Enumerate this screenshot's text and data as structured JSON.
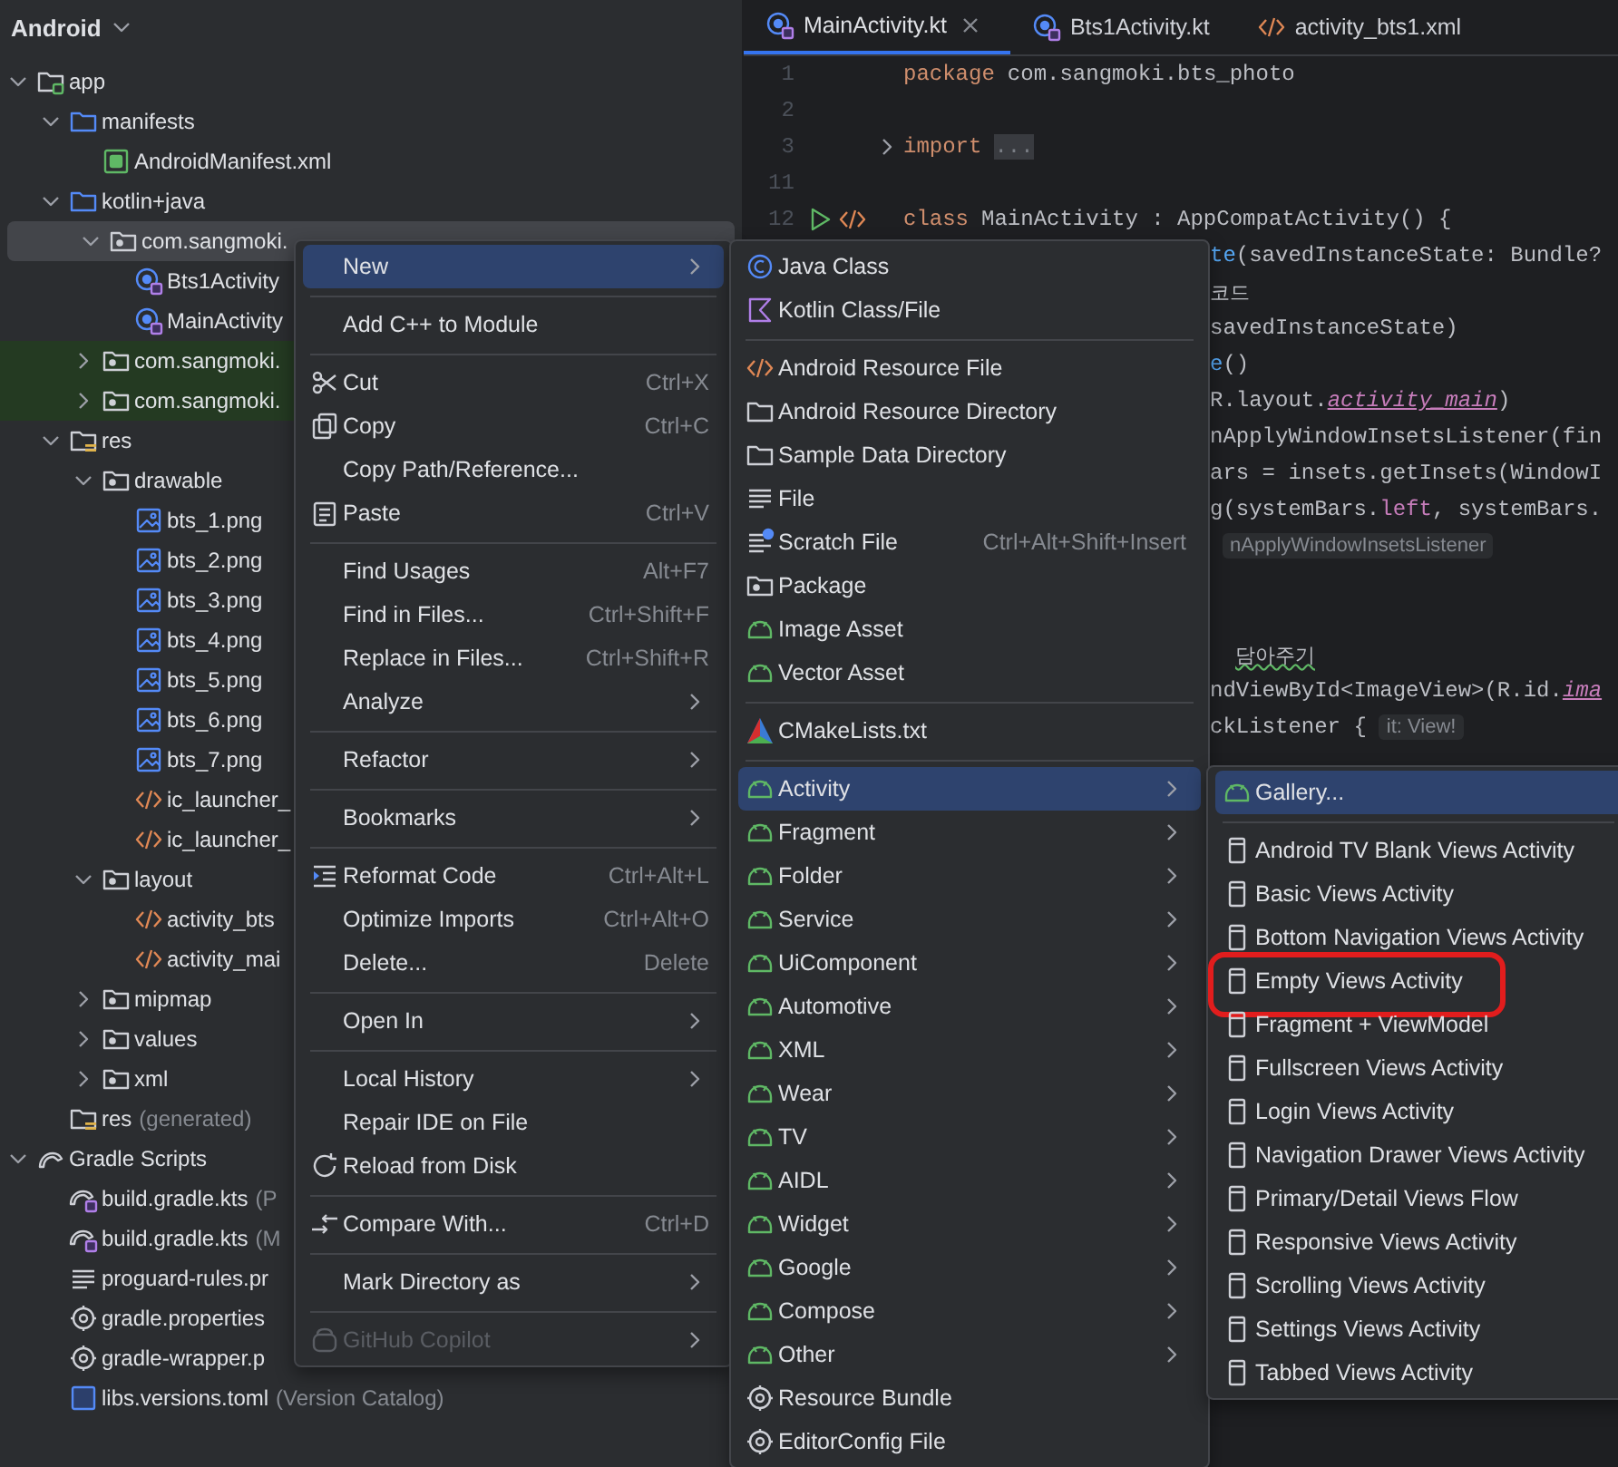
{
  "project_panel": {
    "view": "Android"
  },
  "tree": [
    {
      "label": "app",
      "kind": "module",
      "expanded": true,
      "selected": false,
      "tinted": false,
      "children": [
        {
          "label": "manifests",
          "kind": "folder",
          "expanded": true,
          "selected": false,
          "tinted": false,
          "children": [
            {
              "label": "AndroidManifest.xml",
              "kind": "manifest",
              "selected": false,
              "tinted": false
            }
          ]
        },
        {
          "label": "kotlin+java",
          "kind": "folder",
          "expanded": true,
          "selected": false,
          "tinted": false,
          "children": [
            {
              "label": "com.sangmoki.",
              "kind": "package",
              "expanded": true,
              "selected": true,
              "tinted": false,
              "children": [
                {
                  "label": "Bts1Activity",
                  "kind": "kotlin",
                  "selected": false,
                  "tinted": false
                },
                {
                  "label": "MainActivity",
                  "kind": "kotlin",
                  "selected": false,
                  "tinted": false
                }
              ]
            },
            {
              "label": "com.sangmoki.",
              "kind": "package",
              "expanded": false,
              "selected": false,
              "tinted": true
            },
            {
              "label": "com.sangmoki.",
              "kind": "package",
              "expanded": false,
              "selected": false,
              "tinted": true
            }
          ]
        },
        {
          "label": "res",
          "kind": "resfolder",
          "expanded": true,
          "selected": false,
          "tinted": false,
          "children": [
            {
              "label": "drawable",
              "kind": "package",
              "expanded": true,
              "selected": false,
              "tinted": false,
              "children": [
                {
                  "label": "bts_1.png",
                  "kind": "image",
                  "selected": false,
                  "tinted": false
                },
                {
                  "label": "bts_2.png",
                  "kind": "image",
                  "selected": false,
                  "tinted": false
                },
                {
                  "label": "bts_3.png",
                  "kind": "image",
                  "selected": false,
                  "tinted": false
                },
                {
                  "label": "bts_4.png",
                  "kind": "image",
                  "selected": false,
                  "tinted": false
                },
                {
                  "label": "bts_5.png",
                  "kind": "image",
                  "selected": false,
                  "tinted": false
                },
                {
                  "label": "bts_6.png",
                  "kind": "image",
                  "selected": false,
                  "tinted": false
                },
                {
                  "label": "bts_7.png",
                  "kind": "image",
                  "selected": false,
                  "tinted": false
                },
                {
                  "label": "ic_launcher_",
                  "kind": "xml",
                  "selected": false,
                  "tinted": false
                },
                {
                  "label": "ic_launcher_",
                  "kind": "xml",
                  "selected": false,
                  "tinted": false
                }
              ]
            },
            {
              "label": "layout",
              "kind": "package",
              "expanded": true,
              "selected": false,
              "tinted": false,
              "children": [
                {
                  "label": "activity_bts",
                  "kind": "xml",
                  "selected": false,
                  "tinted": false
                },
                {
                  "label": "activity_mai",
                  "kind": "xml",
                  "selected": false,
                  "tinted": false
                }
              ]
            },
            {
              "label": "mipmap",
              "kind": "package",
              "expanded": false,
              "selected": false,
              "tinted": false
            },
            {
              "label": "values",
              "kind": "package",
              "expanded": false,
              "selected": false,
              "tinted": false
            },
            {
              "label": "xml",
              "kind": "package",
              "expanded": false,
              "selected": false,
              "tinted": false
            }
          ]
        },
        {
          "label": "res",
          "suffix": "(generated)",
          "kind": "resfolder",
          "selected": false,
          "tinted": false
        }
      ]
    },
    {
      "label": "Gradle Scripts",
      "kind": "gradle",
      "expanded": true,
      "selected": false,
      "tinted": false,
      "children": [
        {
          "label": "build.gradle.kts",
          "suffix": "(P",
          "kind": "gradlekts",
          "selected": false,
          "tinted": false
        },
        {
          "label": "build.gradle.kts",
          "suffix": "(M",
          "kind": "gradlekts",
          "selected": false,
          "tinted": false
        },
        {
          "label": "proguard-rules.pr",
          "kind": "text",
          "selected": false,
          "tinted": false
        },
        {
          "label": "gradle.properties",
          "kind": "gear",
          "selected": false,
          "tinted": false
        },
        {
          "label": "gradle-wrapper.p",
          "kind": "gear",
          "selected": false,
          "tinted": false
        },
        {
          "label": "libs.versions.toml",
          "suffix": "(Version Catalog)",
          "kind": "toml",
          "selected": false,
          "tinted": false
        }
      ]
    }
  ],
  "editor": {
    "tabs": [
      {
        "label": "MainActivity.kt",
        "kind": "kotlin",
        "selected": true,
        "closable": true
      },
      {
        "label": "Bts1Activity.kt",
        "kind": "kotlin",
        "selected": false,
        "closable": false
      },
      {
        "label": "activity_bts1.xml",
        "kind": "xml",
        "selected": false,
        "closable": false
      }
    ],
    "lines": [
      {
        "number": "1",
        "tokens": [
          {
            "kind": "keyword",
            "text": "package"
          },
          {
            "kind": "plain",
            "text": "com.sangmoki.bts_photo"
          }
        ]
      },
      {
        "number": "2"
      },
      {
        "number": "3",
        "collapsed": true,
        "tokens": [
          {
            "kind": "keyword",
            "text": "import"
          },
          {
            "kind": "fold",
            "text": "..."
          }
        ]
      },
      {
        "number": "11"
      },
      {
        "number": "12",
        "runnable": true,
        "tokens": [
          {
            "kind": "keyword",
            "text": "class"
          },
          {
            "kind": "plain",
            "text": "MainActivity : AppCompatActivity() {"
          }
        ]
      },
      {
        "partial": true,
        "tokens": [
          {
            "kind": "function",
            "text": "te"
          },
          {
            "kind": "plain",
            "text": "(savedInstanceState: Bundle?"
          }
        ]
      },
      {
        "partial": true,
        "tokens": [
          {
            "kind": "comment",
            "text": "코드"
          }
        ]
      },
      {
        "partial": true,
        "tokens": [
          {
            "kind": "plain",
            "text": "savedInstanceState)"
          }
        ]
      },
      {
        "partial": true,
        "tokens": [
          {
            "kind": "function",
            "text": "e"
          },
          {
            "kind": "plain",
            "text": "()"
          }
        ]
      },
      {
        "partial": true,
        "tokens": [
          {
            "kind": "plain",
            "text": "R.layout."
          },
          {
            "kind": "ref",
            "text": "activity_main"
          },
          {
            "kind": "plain",
            "text": ")"
          }
        ]
      },
      {
        "partial": true,
        "tokens": [
          {
            "kind": "plain",
            "text": "nApplyWindowInsetsListener(fin"
          }
        ]
      },
      {
        "partial": true,
        "tokens": [
          {
            "kind": "plain",
            "text": "ars = insets.getInsets(WindowI"
          }
        ]
      },
      {
        "partial": true,
        "tokens": [
          {
            "kind": "plain",
            "text": "g(systemBars."
          },
          {
            "kind": "field",
            "text": "left"
          },
          {
            "kind": "plain",
            "text": ", systemBars."
          }
        ]
      },
      {
        "partial": true,
        "tokens": [
          {
            "kind": "hint",
            "text": "nApplyWindowInsetsListener"
          }
        ]
      },
      {
        "partial": true,
        "tokens": [
          {
            "kind": "typo",
            "text": "담아주기"
          }
        ]
      },
      {
        "partial": true,
        "tokens": [
          {
            "kind": "plain",
            "text": "ndViewById<ImageView>(R.id."
          },
          {
            "kind": "ref",
            "text": "ima"
          }
        ]
      },
      {
        "partial": true,
        "tokens": [
          {
            "kind": "plain",
            "text": "ckListener {"
          },
          {
            "kind": "hint",
            "text": "it: View!"
          }
        ]
      }
    ]
  },
  "context_menu": {
    "items": [
      {
        "kind": "text",
        "label": "New",
        "selected": true,
        "disabled": false,
        "submenu": true
      },
      {
        "kind": "separator"
      },
      {
        "kind": "text",
        "label": "Add C++ to Module",
        "selected": false,
        "disabled": false
      },
      {
        "kind": "separator"
      },
      {
        "kind": "scissors",
        "label": "Cut",
        "shortcut": "Ctrl+X",
        "selected": false,
        "disabled": false
      },
      {
        "kind": "copy",
        "label": "Copy",
        "shortcut": "Ctrl+C",
        "selected": false,
        "disabled": false
      },
      {
        "kind": "text",
        "label": "Copy Path/Reference...",
        "selected": false,
        "disabled": false
      },
      {
        "kind": "paste",
        "label": "Paste",
        "shortcut": "Ctrl+V",
        "selected": false,
        "disabled": false
      },
      {
        "kind": "separator"
      },
      {
        "kind": "text",
        "label": "Find Usages",
        "shortcut": "Alt+F7",
        "selected": false,
        "disabled": false
      },
      {
        "kind": "text",
        "label": "Find in Files...",
        "shortcut": "Ctrl+Shift+F",
        "selected": false,
        "disabled": false
      },
      {
        "kind": "text",
        "label": "Replace in Files...",
        "shortcut": "Ctrl+Shift+R",
        "selected": false,
        "disabled": false
      },
      {
        "kind": "text",
        "label": "Analyze",
        "selected": false,
        "disabled": false,
        "submenu": true
      },
      {
        "kind": "separator"
      },
      {
        "kind": "text",
        "label": "Refactor",
        "selected": false,
        "disabled": false,
        "submenu": true
      },
      {
        "kind": "separator"
      },
      {
        "kind": "text",
        "label": "Bookmarks",
        "selected": false,
        "disabled": false,
        "submenu": true
      },
      {
        "kind": "separator"
      },
      {
        "kind": "reformat",
        "label": "Reformat Code",
        "shortcut": "Ctrl+Alt+L",
        "selected": false,
        "disabled": false
      },
      {
        "kind": "text",
        "label": "Optimize Imports",
        "shortcut": "Ctrl+Alt+O",
        "selected": false,
        "disabled": false
      },
      {
        "kind": "text",
        "label": "Delete...",
        "shortcut": "Delete",
        "selected": false,
        "disabled": false
      },
      {
        "kind": "separator"
      },
      {
        "kind": "text",
        "label": "Open In",
        "selected": false,
        "disabled": false,
        "submenu": true
      },
      {
        "kind": "separator"
      },
      {
        "kind": "text",
        "label": "Local History",
        "selected": false,
        "disabled": false,
        "submenu": true
      },
      {
        "kind": "text",
        "label": "Repair IDE on File",
        "selected": false,
        "disabled": false
      },
      {
        "kind": "reload",
        "label": "Reload from Disk",
        "selected": false,
        "disabled": false
      },
      {
        "kind": "separator"
      },
      {
        "kind": "compare",
        "label": "Compare With...",
        "shortcut": "Ctrl+D",
        "selected": false,
        "disabled": false
      },
      {
        "kind": "separator"
      },
      {
        "kind": "text",
        "label": "Mark Directory as",
        "selected": false,
        "disabled": false,
        "submenu": true
      },
      {
        "kind": "separator"
      },
      {
        "kind": "copilot",
        "label": "GitHub Copilot",
        "selected": false,
        "disabled": true,
        "submenu": true
      }
    ]
  },
  "new_submenu": {
    "items": [
      {
        "kind": "java",
        "label": "Java Class",
        "selected": false
      },
      {
        "kind": "kotlinfile",
        "label": "Kotlin Class/File",
        "selected": false
      },
      {
        "kind": "separator"
      },
      {
        "kind": "xml",
        "label": "Android Resource File",
        "selected": false
      },
      {
        "kind": "folderplain",
        "label": "Android Resource Directory",
        "selected": false
      },
      {
        "kind": "folderplain",
        "label": "Sample Data Directory",
        "selected": false
      },
      {
        "kind": "file",
        "label": "File",
        "selected": false
      },
      {
        "kind": "scratch",
        "label": "Scratch File",
        "shortcut": "Ctrl+Alt+Shift+Insert",
        "selected": false
      },
      {
        "kind": "package",
        "label": "Package",
        "selected": false
      },
      {
        "kind": "android",
        "label": "Image Asset",
        "selected": false
      },
      {
        "kind": "android",
        "label": "Vector Asset",
        "selected": false
      },
      {
        "kind": "separator"
      },
      {
        "kind": "cmake",
        "label": "CMakeLists.txt",
        "selected": false
      },
      {
        "kind": "separator"
      },
      {
        "kind": "android",
        "label": "Activity",
        "selected": true,
        "submenu": true
      },
      {
        "kind": "android",
        "label": "Fragment",
        "selected": false,
        "submenu": true
      },
      {
        "kind": "android",
        "label": "Folder",
        "selected": false,
        "submenu": true
      },
      {
        "kind": "android",
        "label": "Service",
        "selected": false,
        "submenu": true
      },
      {
        "kind": "android",
        "label": "UiComponent",
        "selected": false,
        "submenu": true
      },
      {
        "kind": "android",
        "label": "Automotive",
        "selected": false,
        "submenu": true
      },
      {
        "kind": "android",
        "label": "XML",
        "selected": false,
        "submenu": true
      },
      {
        "kind": "android",
        "label": "Wear",
        "selected": false,
        "submenu": true
      },
      {
        "kind": "android",
        "label": "TV",
        "selected": false,
        "submenu": true
      },
      {
        "kind": "android",
        "label": "AIDL",
        "selected": false,
        "submenu": true
      },
      {
        "kind": "android",
        "label": "Widget",
        "selected": false,
        "submenu": true
      },
      {
        "kind": "android",
        "label": "Google",
        "selected": false,
        "submenu": true
      },
      {
        "kind": "android",
        "label": "Compose",
        "selected": false,
        "submenu": true
      },
      {
        "kind": "android",
        "label": "Other",
        "selected": false,
        "submenu": true
      },
      {
        "kind": "gear",
        "label": "Resource Bundle",
        "selected": false
      },
      {
        "kind": "gear",
        "label": "EditorConfig File",
        "selected": false
      }
    ]
  },
  "activity_submenu": {
    "items": [
      {
        "kind": "android",
        "label": "Gallery...",
        "selected": true,
        "highlighted": false
      },
      {
        "kind": "separator"
      },
      {
        "kind": "phone",
        "label": "Android TV Blank Views Activity",
        "selected": false,
        "highlighted": false
      },
      {
        "kind": "phone",
        "label": "Basic Views Activity",
        "selected": false,
        "highlighted": false
      },
      {
        "kind": "phone",
        "label": "Bottom Navigation Views Activity",
        "selected": false,
        "highlighted": false
      },
      {
        "kind": "phone",
        "label": "Empty Views Activity",
        "selected": false,
        "highlighted": true
      },
      {
        "kind": "phone",
        "label": "Fragment + ViewModel",
        "selected": false,
        "highlighted": false
      },
      {
        "kind": "phone",
        "label": "Fullscreen Views Activity",
        "selected": false,
        "highlighted": false
      },
      {
        "kind": "phone",
        "label": "Login Views Activity",
        "selected": false,
        "highlighted": false
      },
      {
        "kind": "phone",
        "label": "Navigation Drawer Views Activity",
        "selected": false,
        "highlighted": false
      },
      {
        "kind": "phone",
        "label": "Primary/Detail Views Flow",
        "selected": false,
        "highlighted": false
      },
      {
        "kind": "phone",
        "label": "Responsive Views Activity",
        "selected": false,
        "highlighted": false
      },
      {
        "kind": "phone",
        "label": "Scrolling Views Activity",
        "selected": false,
        "highlighted": false
      },
      {
        "kind": "phone",
        "label": "Settings Views Activity",
        "selected": false,
        "highlighted": false
      },
      {
        "kind": "phone",
        "label": "Tabbed Views Activity",
        "selected": false,
        "highlighted": false
      }
    ]
  }
}
